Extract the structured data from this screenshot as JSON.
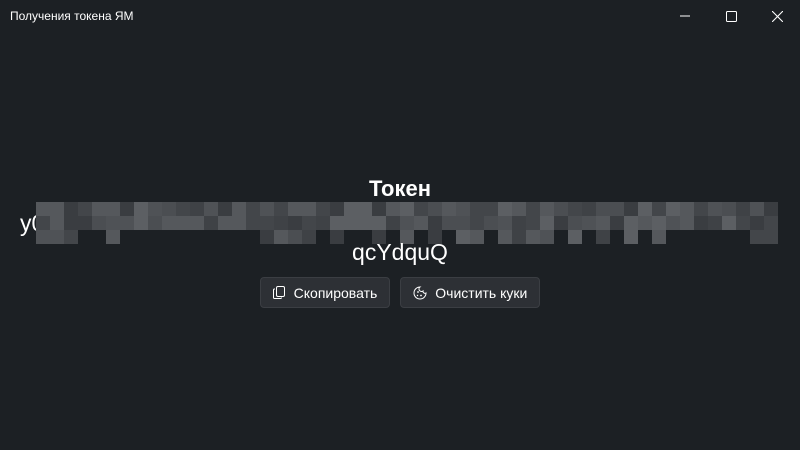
{
  "window": {
    "title": "Получения токена ЯМ"
  },
  "controls": {
    "minimize_icon": "minimize-icon",
    "maximize_icon": "maximize-icon",
    "close_icon": "close-icon"
  },
  "main": {
    "heading": "Токен",
    "token_prefix": "y0_",
    "token_suffix": "qcYdquQ",
    "copy_label": "Скопировать",
    "copy_icon": "copy-icon",
    "clear_label": "Очистить куки",
    "clear_icon": "cookie-icon"
  },
  "colors": {
    "background": "#1c2024",
    "button_bg": "#2d3035",
    "text": "#ffffff"
  }
}
